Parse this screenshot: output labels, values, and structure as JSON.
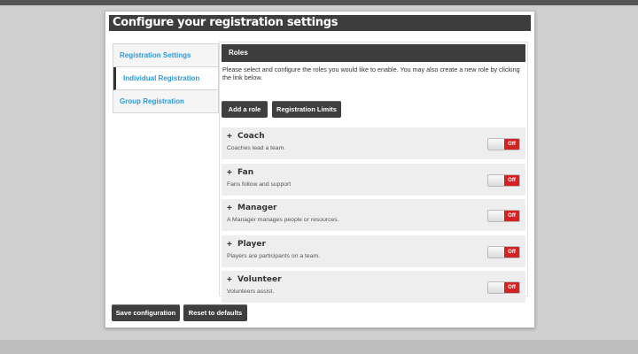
{
  "page_title": "Configure your registration settings",
  "sidebar": {
    "items": [
      {
        "label": "Registration Settings"
      },
      {
        "label": "Individual Registration"
      },
      {
        "label": "Group Registration"
      }
    ]
  },
  "roles": {
    "header": "Roles",
    "intro": "Please select and configure the roles you would like to enable. You may also create a new role by clicking the link below.",
    "add_role_label": "Add a role",
    "limits_label": "Registration Limits",
    "list": [
      {
        "name": "Coach",
        "description": "Coaches lead a team.",
        "toggle": "Off"
      },
      {
        "name": "Fan",
        "description": "Fans follow and support",
        "toggle": "Off"
      },
      {
        "name": "Manager",
        "description": "A Manager manages people or resources.",
        "toggle": "Off"
      },
      {
        "name": "Player",
        "description": "Players are participants on a team.",
        "toggle": "Off"
      },
      {
        "name": "Volunteer",
        "description": "Volunteers assist.",
        "toggle": "Off"
      }
    ]
  },
  "footer": {
    "save_label": "Save configuration",
    "reset_label": "Reset to defaults"
  },
  "colors": {
    "header_bg": "#3d3d3d",
    "link_blue": "#2b9ad8",
    "toggle_off_red": "#d42222"
  }
}
